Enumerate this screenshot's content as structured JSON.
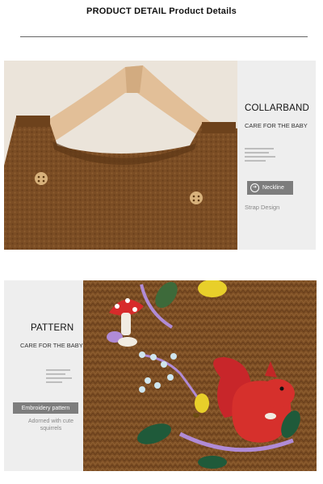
{
  "header": {
    "title": "PRODUCT DETAIL Product Details"
  },
  "sections": [
    {
      "heading": "COLLARBAND",
      "subheading": "CARE FOR THE BABY",
      "tag": "Neckline",
      "caption": "Strap Design"
    },
    {
      "heading": "PATTERN",
      "subheading": "CARE FOR THE BABY",
      "tag": "Embroidery pattern",
      "caption": "Adorned with cute squirrels"
    }
  ],
  "colors": {
    "knit_brown": "#7a4c22",
    "panel_gray": "#eeeeee",
    "tag_gray": "#7d7d7d"
  }
}
